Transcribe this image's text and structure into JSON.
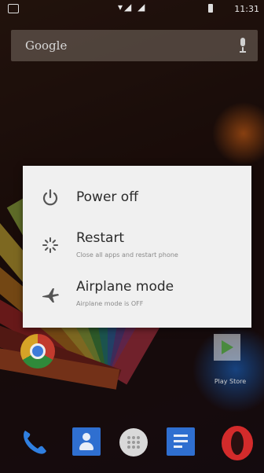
{
  "statusbar": {
    "time": "11:31"
  },
  "search": {
    "logo_text": "Google"
  },
  "home": {
    "play_store_label": "Play Store"
  },
  "power_menu": {
    "options": [
      {
        "label": "Power off",
        "subtitle": "",
        "icon": "power-icon"
      },
      {
        "label": "Restart",
        "subtitle": "Close all apps and restart phone",
        "icon": "restart-icon"
      },
      {
        "label": "Airplane mode",
        "subtitle": "Airplane mode is OFF",
        "icon": "airplane-icon"
      }
    ]
  },
  "dock": {
    "apps": [
      "phone-icon",
      "contacts-icon",
      "app-drawer-icon",
      "messages-icon",
      "opera-icon"
    ]
  }
}
